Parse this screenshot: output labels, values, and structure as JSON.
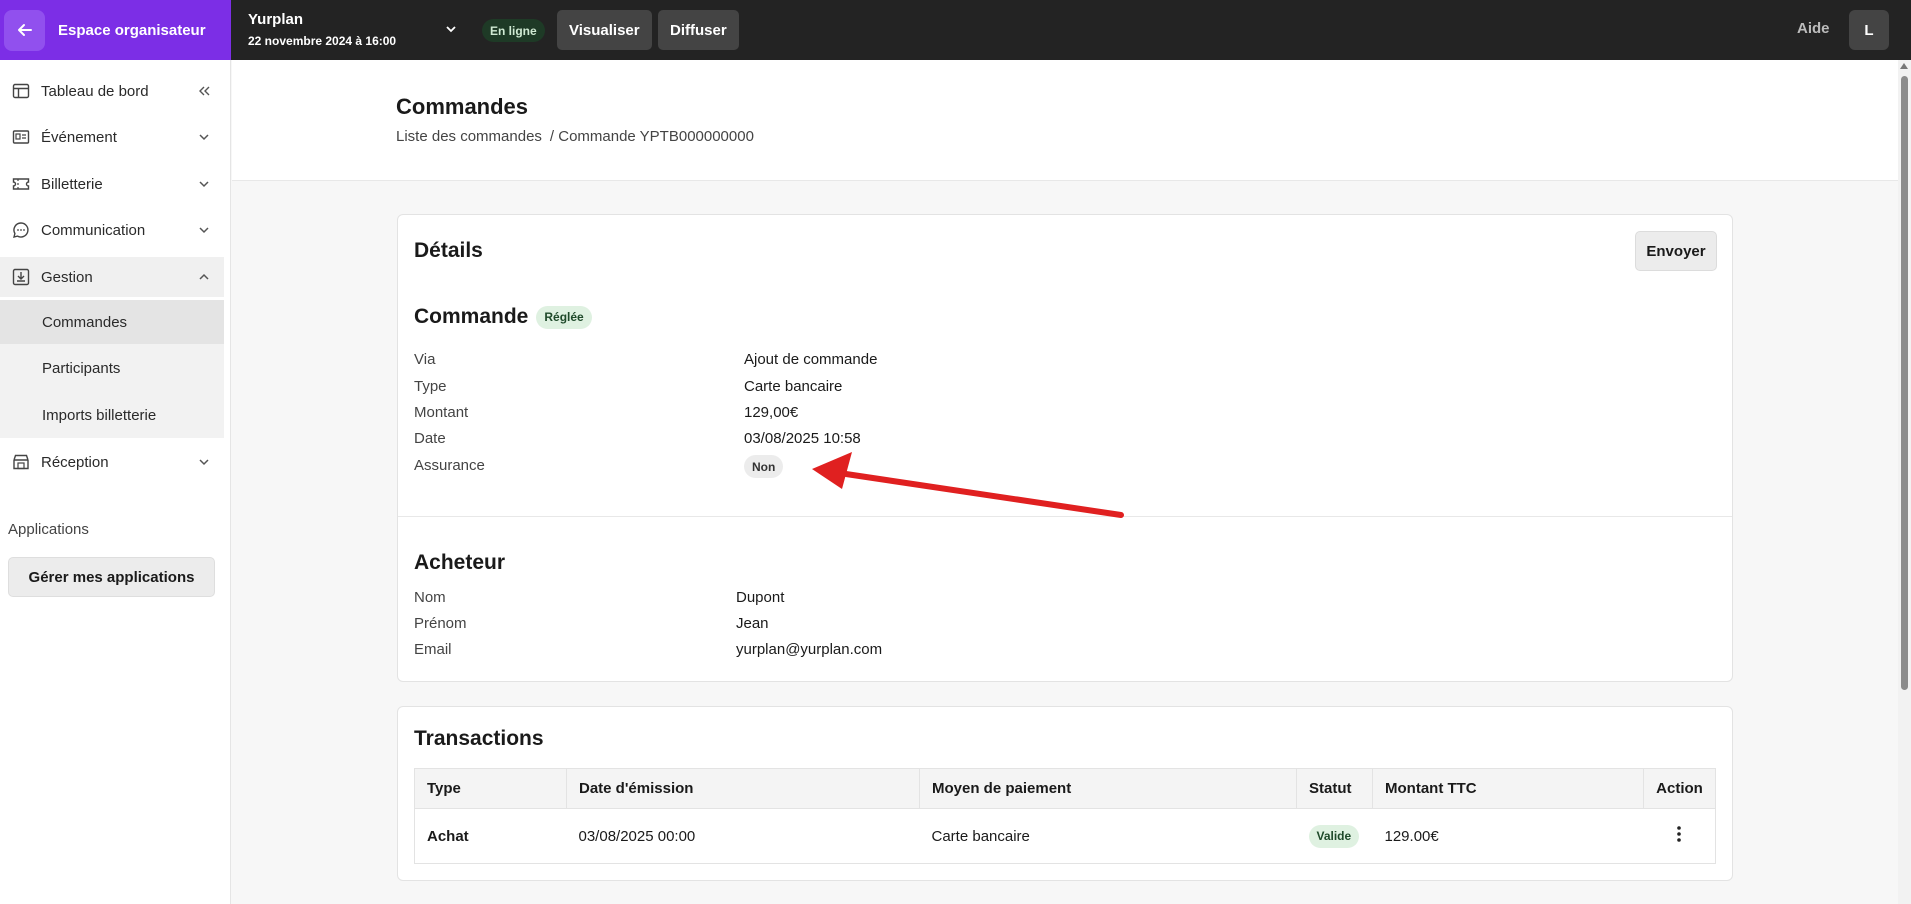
{
  "topbar": {
    "brand_label": "Espace organisateur",
    "event_name": "Yurplan",
    "event_date": "22 novembre 2024 à 16:00",
    "status_badge": "En ligne",
    "preview_button": "Visualiser",
    "publish_button": "Diffuser",
    "help_link": "Aide",
    "avatar_initial": "L"
  },
  "sidebar": {
    "items": [
      {
        "label": "Tableau de bord",
        "icon": "layout-icon"
      },
      {
        "label": "Événement",
        "icon": "id-card-icon"
      },
      {
        "label": "Billetterie",
        "icon": "ticket-icon"
      },
      {
        "label": "Communication",
        "icon": "chat-icon"
      },
      {
        "label": "Gestion",
        "icon": "download-box-icon"
      },
      {
        "label": "Réception",
        "icon": "store-icon"
      }
    ],
    "gestion_children": [
      "Commandes",
      "Participants",
      "Imports billetterie"
    ],
    "applications_title": "Applications",
    "applications_button": "Gérer mes applications"
  },
  "page": {
    "title": "Commandes",
    "breadcrumb": [
      "Liste des commandes",
      "/ Commande YPTB000000000"
    ]
  },
  "details": {
    "title": "Détails",
    "send_button": "Envoyer",
    "order": {
      "title": "Commande",
      "status": "Réglée",
      "rows": [
        {
          "label": "Via",
          "value": "Ajout de commande"
        },
        {
          "label": "Type",
          "value": "Carte bancaire"
        },
        {
          "label": "Montant",
          "value": "129,00€"
        },
        {
          "label": "Date",
          "value": "03/08/2025 10:58"
        },
        {
          "label": "Assurance",
          "value": "Non"
        }
      ]
    },
    "buyer": {
      "title": "Acheteur",
      "rows": [
        {
          "label": "Nom",
          "value": "Dupont"
        },
        {
          "label": "Prénom",
          "value": "Jean"
        },
        {
          "label": "Email",
          "value": "yurplan@yurplan.com"
        }
      ]
    }
  },
  "transactions": {
    "title": "Transactions",
    "columns": [
      "Type",
      "Date d'émission",
      "Moyen de paiement",
      "Statut",
      "Montant TTC",
      "Action"
    ],
    "rows": [
      {
        "type": "Achat",
        "date": "03/08/2025 00:00",
        "method": "Carte bancaire",
        "status": "Valide",
        "amount": "129.00€"
      }
    ]
  },
  "colors": {
    "brand": "#7c2ee6",
    "topbar": "#232323",
    "success_bg": "#dff1e1",
    "annotation_arrow": "#e02020"
  }
}
